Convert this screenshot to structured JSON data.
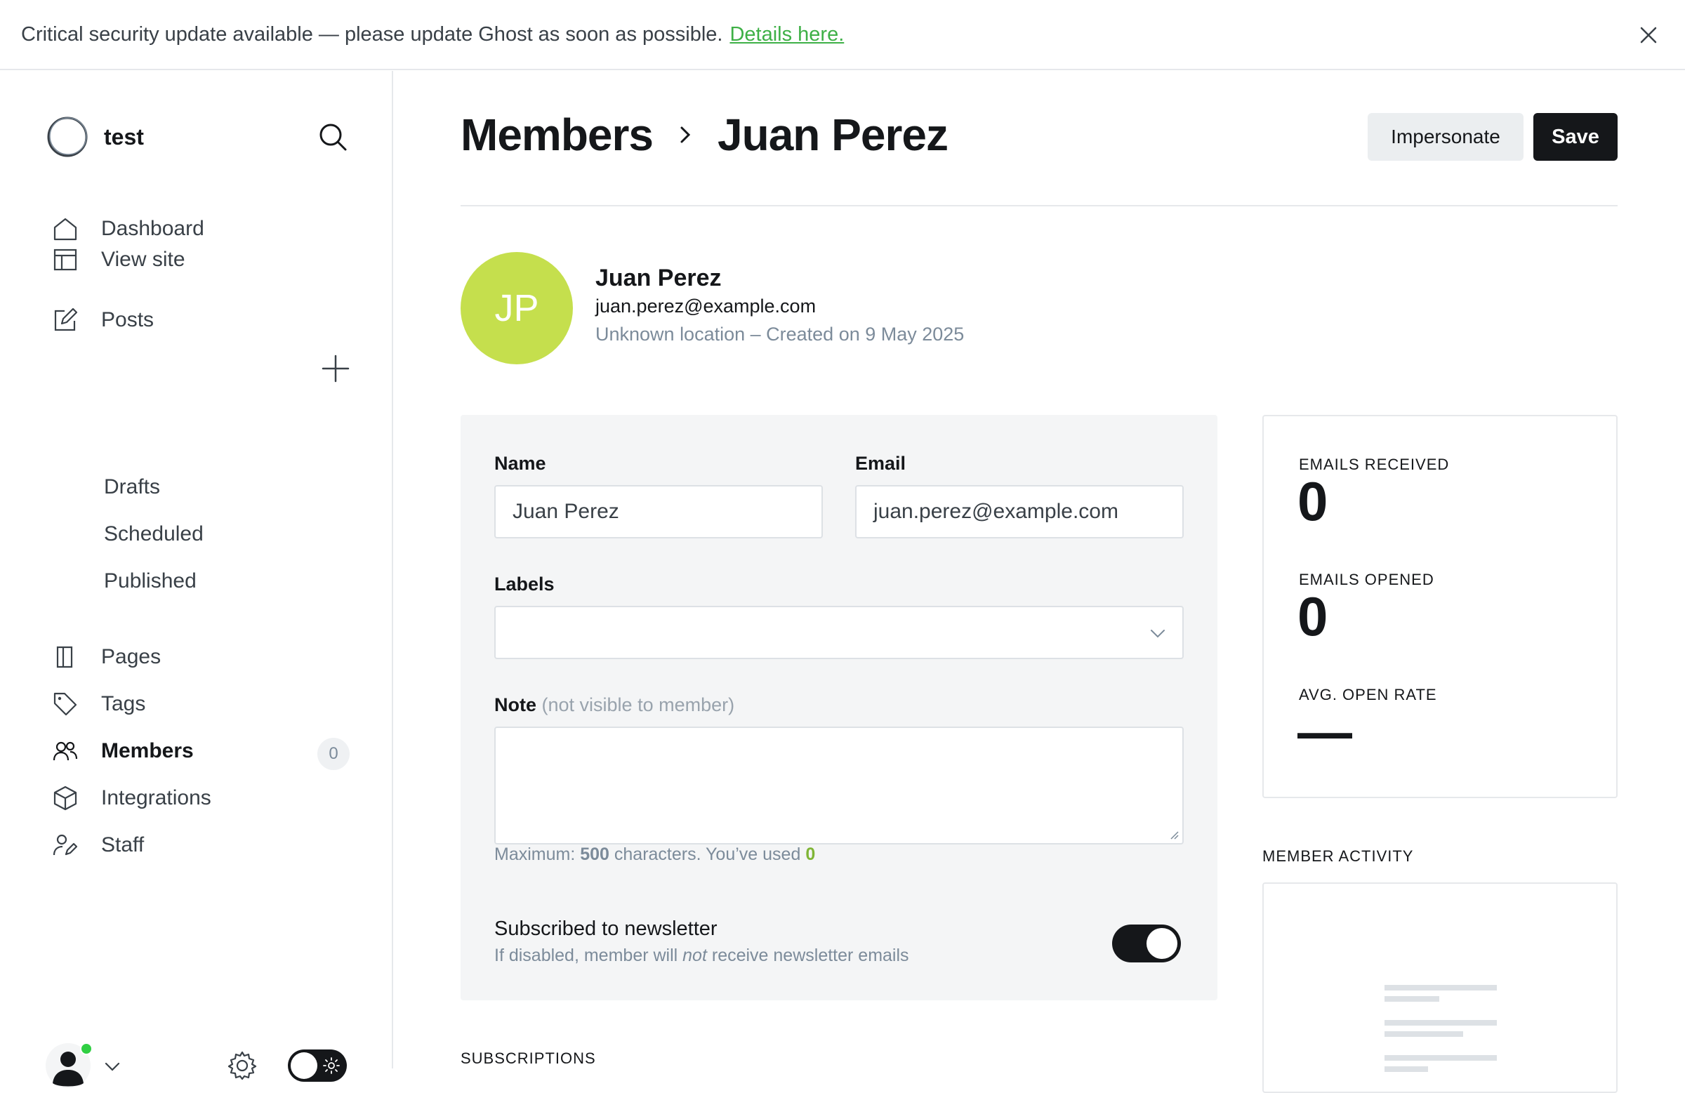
{
  "banner": {
    "message": "Critical security update available — please update Ghost as soon as possible.",
    "link": "Details here."
  },
  "sidebar": {
    "site_name": "test",
    "items": [
      {
        "label": "Dashboard",
        "icon": "home-icon"
      },
      {
        "label": "View site",
        "icon": "layout-icon"
      },
      {
        "label": "Posts",
        "icon": "edit-icon"
      },
      {
        "label": "Pages",
        "icon": "page-icon"
      },
      {
        "label": "Tags",
        "icon": "tag-icon"
      },
      {
        "label": "Members",
        "icon": "members-icon",
        "badge": "0",
        "active": true
      },
      {
        "label": "Integrations",
        "icon": "box-icon"
      },
      {
        "label": "Staff",
        "icon": "staff-icon"
      }
    ],
    "post_subitems": [
      "Drafts",
      "Scheduled",
      "Published"
    ]
  },
  "header": {
    "breadcrumb_parent": "Members",
    "title": "Juan Perez",
    "impersonate_label": "Impersonate",
    "save_label": "Save"
  },
  "member": {
    "initials": "JP",
    "name": "Juan Perez",
    "email": "juan.perez@example.com",
    "meta": "Unknown location – Created on 9 May 2025",
    "avatar_color": "#c5df4d"
  },
  "form": {
    "name_label": "Name",
    "name_value": "Juan Perez",
    "email_label": "Email",
    "email_value": "juan.perez@example.com",
    "labels_label": "Labels",
    "labels_value": "",
    "note_label": "Note",
    "note_hint": "(not visible to member)",
    "note_value": "",
    "max_prefix": "Maximum: ",
    "max_value": "500",
    "max_middle": " characters. You’ve used ",
    "used_value": "0",
    "newsletter_title": "Subscribed to newsletter",
    "newsletter_desc_before": "If disabled, member will ",
    "newsletter_desc_em": "not",
    "newsletter_desc_after": " receive newsletter emails",
    "newsletter_enabled": true
  },
  "stats": {
    "emails_received_label": "EMAILS RECEIVED",
    "emails_received_value": "0",
    "emails_opened_label": "EMAILS OPENED",
    "emails_opened_value": "0",
    "open_rate_label": "AVG. OPEN RATE",
    "open_rate_value": "—"
  },
  "sections": {
    "member_activity": "MEMBER ACTIVITY",
    "subscriptions": "SUBSCRIPTIONS"
  },
  "colors": {
    "accent_link": "#3eb046",
    "primary_dark": "#15171a",
    "online_dot": "#30cf43"
  }
}
